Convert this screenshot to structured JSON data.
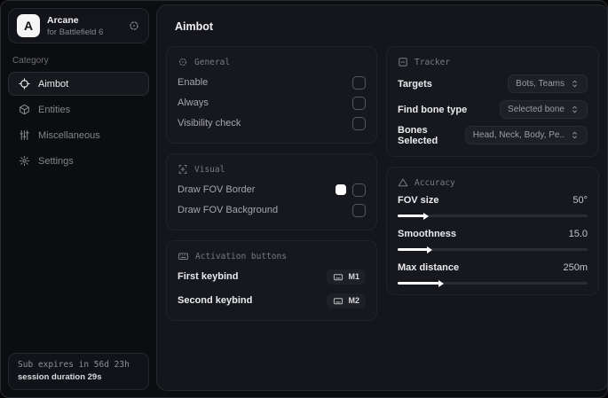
{
  "sidebar": {
    "logo_letter": "A",
    "app_name": "Arcane",
    "app_subtitle": "for Battlefield 6",
    "category_label": "Category",
    "items": [
      {
        "label": "Aimbot",
        "icon": "crosshair-icon",
        "active": true
      },
      {
        "label": "Entities",
        "icon": "cube-icon",
        "active": false
      },
      {
        "label": "Miscellaneous",
        "icon": "sliders-icon",
        "active": false
      },
      {
        "label": "Settings",
        "icon": "gear-icon",
        "active": false
      }
    ],
    "subscription": {
      "expires_text": "Sub expires in 56d 23h",
      "session_text": "session duration 29s"
    }
  },
  "main": {
    "title": "Aimbot",
    "general": {
      "title": "General",
      "rows": [
        {
          "label": "Enable",
          "checked": false
        },
        {
          "label": "Always",
          "checked": false
        },
        {
          "label": "Visibility check",
          "checked": false
        }
      ]
    },
    "visual": {
      "title": "Visual",
      "rows": [
        {
          "label": "Draw FOV Border",
          "swatch_color": "#ffffff",
          "checked": false
        },
        {
          "label": "Draw FOV Background",
          "checked": false
        }
      ]
    },
    "activation": {
      "title": "Activation buttons",
      "rows": [
        {
          "label": "First keybind",
          "key": "M1"
        },
        {
          "label": "Second keybind",
          "key": "M2"
        }
      ]
    },
    "tracker": {
      "title": "Tracker",
      "rows": [
        {
          "label": "Targets",
          "value": "Bots, Teams"
        },
        {
          "label": "Find bone type",
          "value": "Selected bone"
        },
        {
          "label": "Bones Selected",
          "value": "Head, Neck, Body, Pe.."
        }
      ]
    },
    "accuracy": {
      "title": "Accuracy",
      "sliders": [
        {
          "label": "FOV size",
          "value": "50°",
          "percent": 14
        },
        {
          "label": "Smoothness",
          "value": "15.0",
          "percent": 16
        },
        {
          "label": "Max distance",
          "value": "250m",
          "percent": 22
        }
      ]
    }
  },
  "colors": {
    "window_bg": "#0c0d10",
    "panel_bg": "#15161b",
    "card_bg": "#17181d",
    "accent_white": "#ffffff"
  }
}
